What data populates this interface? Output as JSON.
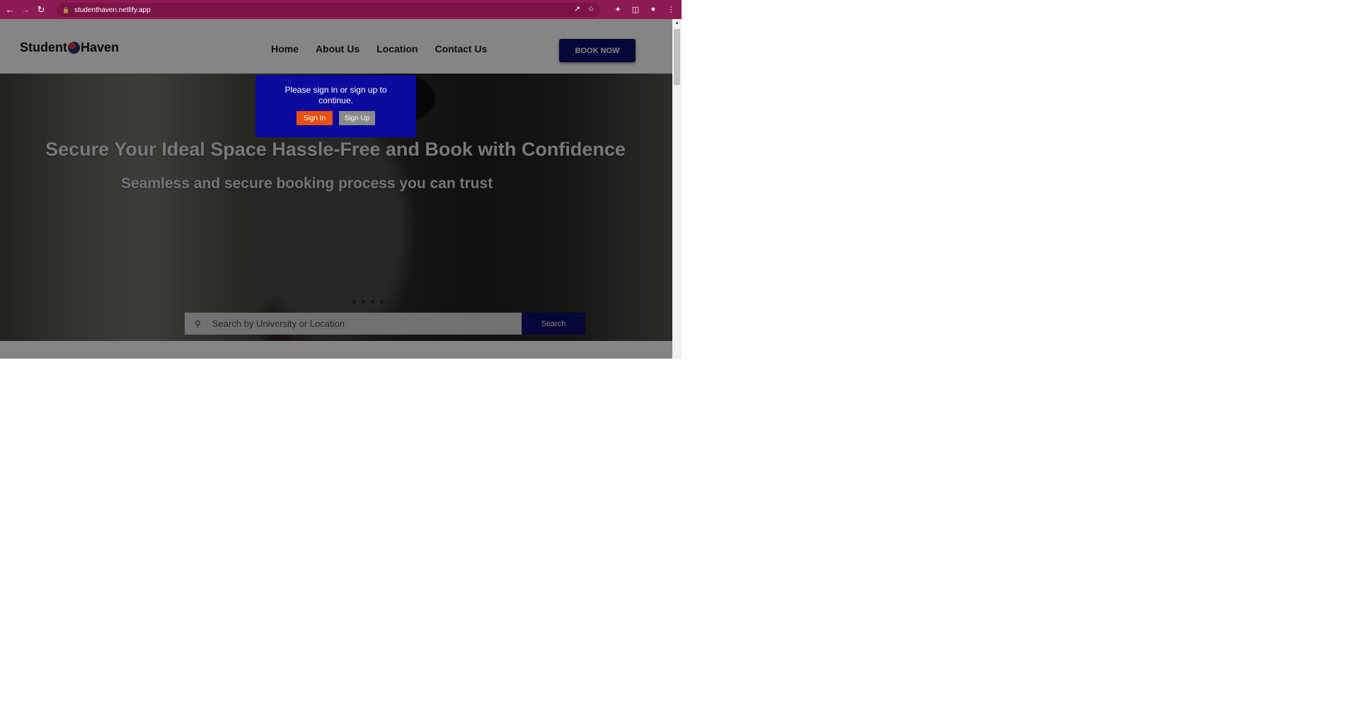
{
  "browser": {
    "url": "studenthaven.netlify.app",
    "icons": {
      "back": "back-arrow-icon",
      "forward": "forward-arrow-icon",
      "reload": "reload-icon",
      "lock": "lock-icon",
      "share": "share-icon",
      "bookmark": "star-icon",
      "extensions": "puzzle-icon",
      "side_panel": "side-panel-icon",
      "profile": "profile-icon",
      "menu": "kebab-menu-icon"
    },
    "theme_color": "#8e1a54"
  },
  "header": {
    "logo_left": "Student",
    "logo_right": "Haven",
    "nav": [
      {
        "label": "Home"
      },
      {
        "label": "About Us"
      },
      {
        "label": "Location"
      },
      {
        "label": "Contact Us"
      }
    ],
    "cta_label": "BOOK NOW"
  },
  "hero": {
    "title": "Secure Your Ideal Space Hassle-Free and Book with Confidence",
    "subtitle": "Seamless and secure booking process you can trust",
    "carousel_slides": 4,
    "search": {
      "placeholder": "Search by University or Location",
      "button_label": "Search"
    }
  },
  "auth_modal": {
    "message": "Please sign in or sign up to continue.",
    "sign_in_label": "Sign In",
    "sign_up_label": "Sign Up"
  },
  "colors": {
    "primary": "#0d0d6b",
    "modal_bg": "#0a0a9c",
    "sign_in": "#e8500f",
    "sign_up": "#8a8a8a"
  }
}
